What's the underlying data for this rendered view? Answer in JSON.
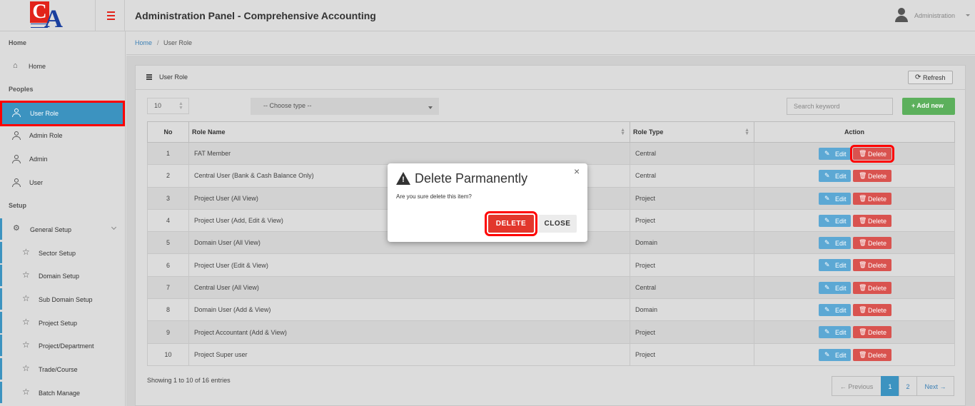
{
  "header": {
    "logo_letters": [
      "C",
      "A"
    ],
    "toggle_icon": "hamburger-icon",
    "title": "Administration Panel - Comprehensive Accounting",
    "user_name": "Administration"
  },
  "sidebar": {
    "sections": {
      "home": "Home",
      "peoples": "Peoples",
      "setup": "Setup"
    },
    "items": [
      {
        "label": "Home",
        "icon": "home-icon"
      },
      {
        "label": "User Role",
        "icon": "user-icon",
        "active": true
      },
      {
        "label": "Admin Role",
        "icon": "user-icon"
      },
      {
        "label": "Admin",
        "icon": "user-icon"
      },
      {
        "label": "User",
        "icon": "user-icon"
      },
      {
        "label": "General Setup",
        "icon": "gear-icon"
      }
    ],
    "sub_items": [
      {
        "label": "Sector Setup",
        "icon": "star-icon"
      },
      {
        "label": "Domain Setup",
        "icon": "star-icon"
      },
      {
        "label": "Sub Domain Setup",
        "icon": "star-icon"
      },
      {
        "label": "Project Setup",
        "icon": "star-icon"
      },
      {
        "label": "Project/Department",
        "icon": "star-icon"
      },
      {
        "label": "Trade/Course",
        "icon": "star-icon"
      },
      {
        "label": "Batch Manage",
        "icon": "star-icon"
      }
    ]
  },
  "breadcrumb": {
    "home": "Home",
    "separator": "/",
    "current": "User Role"
  },
  "panel": {
    "title": "User Role",
    "refresh_label": "Refresh",
    "page_length": "10",
    "type_select": "-- Choose type --",
    "search_placeholder": "Search keyword",
    "add_label": "+ Add new"
  },
  "table": {
    "headers": {
      "no": "No",
      "role_name": "Role Name",
      "role_type": "Role Type",
      "action": "Action"
    },
    "edit_label": "Edit",
    "delete_label": "Delete",
    "rows": [
      {
        "no": "1",
        "name": "FAT Member",
        "type": "Central"
      },
      {
        "no": "2",
        "name": "Central User (Bank & Cash Balance Only)",
        "type": "Central"
      },
      {
        "no": "3",
        "name": "Project User (All View)",
        "type": "Project"
      },
      {
        "no": "4",
        "name": "Project User (Add, Edit & View)",
        "type": "Project"
      },
      {
        "no": "5",
        "name": "Domain User (All View)",
        "type": "Domain"
      },
      {
        "no": "6",
        "name": "Project User (Edit & View)",
        "type": "Project"
      },
      {
        "no": "7",
        "name": "Central User (All View)",
        "type": "Central"
      },
      {
        "no": "8",
        "name": "Domain User (Add & View)",
        "type": "Domain"
      },
      {
        "no": "9",
        "name": "Project Accountant (Add & View)",
        "type": "Project"
      },
      {
        "no": "10",
        "name": "Project Super user",
        "type": "Project"
      }
    ]
  },
  "footer": {
    "info": "Showing 1 to 10 of 16 entries",
    "prev": "← Previous",
    "pages": [
      "1",
      "2"
    ],
    "next": "Next →"
  },
  "modal": {
    "title": "Delete Parmanently",
    "body": "Are you sure delete this item?",
    "delete_label": "DELETE",
    "close_label": "CLOSE",
    "close_icon": "×"
  },
  "colors": {
    "accent": "#3c93c0",
    "danger": "#d9534f",
    "success": "#5cb05c",
    "highlight": "#ff0000"
  }
}
